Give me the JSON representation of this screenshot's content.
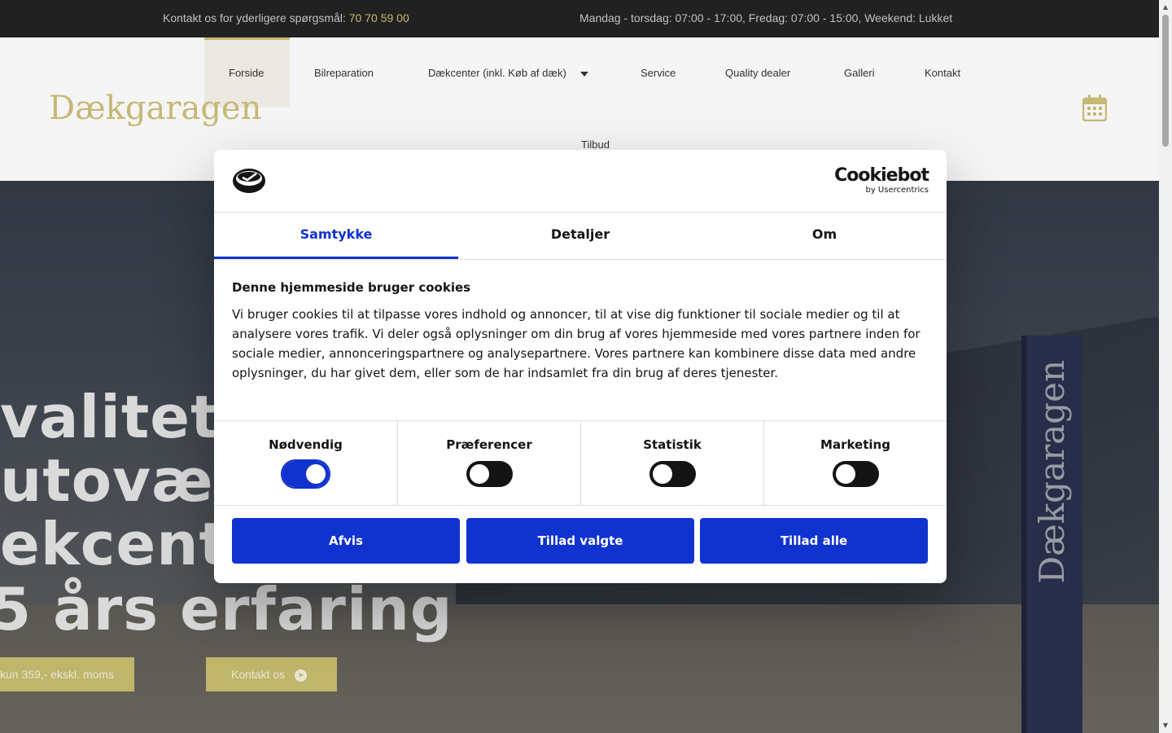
{
  "topbar": {
    "contact_text": "Kontakt os for yderligere spørgsmål: ",
    "phone": "70 70 59 00",
    "hours": "Mandag - torsdag: 07:00 - 17:00, Fredag: 07:00 - 15:00, Weekend: Lukket"
  },
  "header": {
    "logo": "Dækgaragen",
    "nav": [
      {
        "label": "Forside"
      },
      {
        "label": "Bilreparation"
      },
      {
        "label": "Dækcenter (inkl. Køb af dæk)"
      },
      {
        "label": "Service"
      },
      {
        "label": "Quality dealer"
      },
      {
        "label": "Galleri"
      },
      {
        "label": "Kontakt"
      },
      {
        "label": "Tilbud"
      }
    ],
    "calendar_icon": "calendar-icon"
  },
  "hero": {
    "lines": [
      "valitetsb",
      "utoværks",
      "ekcenter",
      "5 års erfaring"
    ],
    "button_left": "kun 359,- ekskl. moms",
    "button_right": "Kontakt os",
    "sign_text": "Dækgaragen"
  },
  "cookie": {
    "brand": "Cookiebot",
    "brand_sub": "by Usercentrics",
    "tabs": [
      {
        "label": "Samtykke",
        "active": true
      },
      {
        "label": "Detaljer",
        "active": false
      },
      {
        "label": "Om",
        "active": false
      }
    ],
    "title": "Denne hjemmeside bruger cookies",
    "body": "Vi bruger cookies til at tilpasse vores indhold og annoncer, til at vise dig funktioner til sociale medier og til at analysere vores trafik. Vi deler også oplysninger om din brug af vores hjemmeside med vores partnere inden for sociale medier, annonceringspartnere og analysepartnere. Vores partnere kan kombinere disse data med andre oplysninger, du har givet dem, eller som de har indsamlet fra din brug af deres tjenester.",
    "toggles": [
      {
        "label": "Nødvendig",
        "on": true
      },
      {
        "label": "Præferencer",
        "on": false
      },
      {
        "label": "Statistik",
        "on": false
      },
      {
        "label": "Marketing",
        "on": false
      }
    ],
    "buttons": {
      "reject": "Afvis",
      "allow_selected": "Tillad valgte",
      "allow_all": "Tillad alle"
    },
    "accent_color": "#1032cf"
  },
  "brand_color": "#d2c070"
}
